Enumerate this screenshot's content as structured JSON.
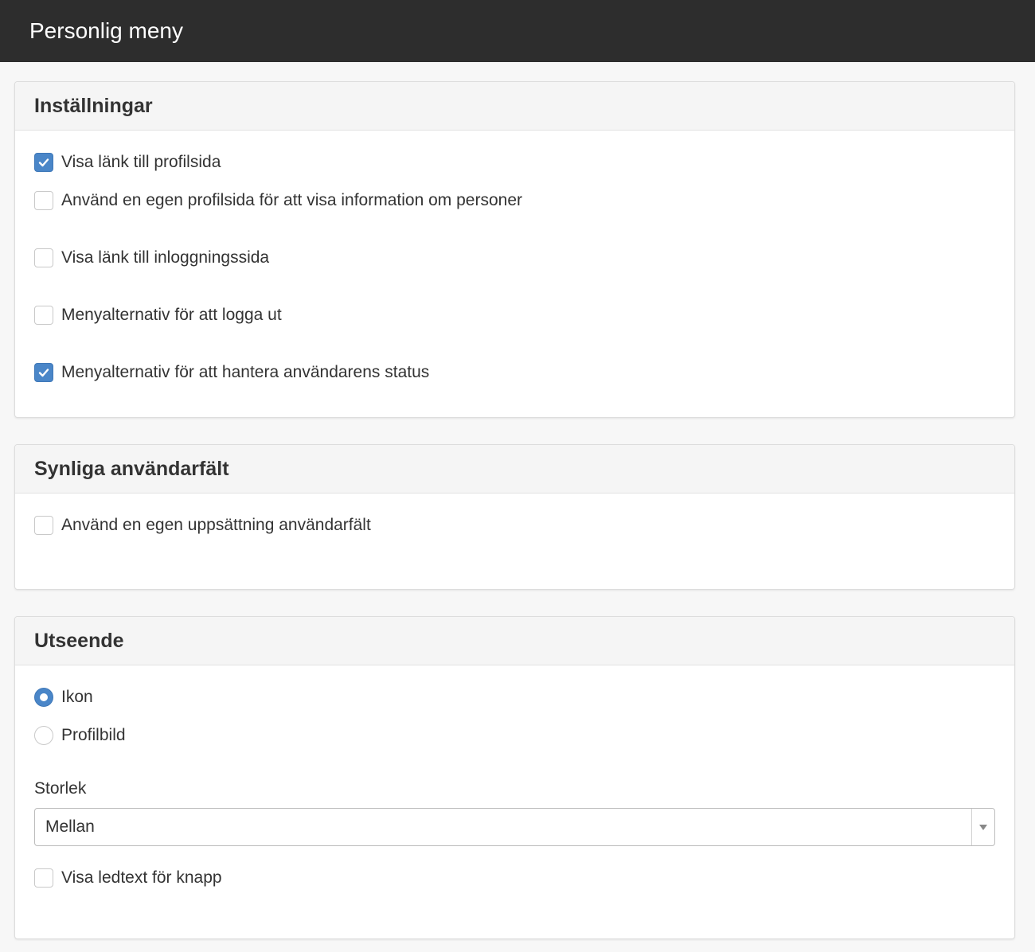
{
  "header": {
    "title": "Personlig meny"
  },
  "settings": {
    "title": "Inställningar",
    "items": [
      {
        "label": "Visa länk till profilsida",
        "checked": true
      },
      {
        "label": "Använd en egen profilsida för att visa information om personer",
        "checked": false
      },
      {
        "label": "Visa länk till inloggningssida",
        "checked": false
      },
      {
        "label": "Menyalternativ för att logga ut",
        "checked": false
      },
      {
        "label": "Menyalternativ för att hantera användarens status",
        "checked": true
      }
    ]
  },
  "visible_fields": {
    "title": "Synliga användarfält",
    "items": [
      {
        "label": "Använd en egen uppsättning användarfält",
        "checked": false
      }
    ]
  },
  "appearance": {
    "title": "Utseende",
    "radios": [
      {
        "label": "Ikon",
        "selected": true
      },
      {
        "label": "Profilbild",
        "selected": false
      }
    ],
    "size_label": "Storlek",
    "size_value": "Mellan",
    "tooltip_checkbox": {
      "label": "Visa ledtext för knapp",
      "checked": false
    }
  },
  "colors": {
    "topbar": "#2d2d2d",
    "accent": "#4a86c8"
  }
}
